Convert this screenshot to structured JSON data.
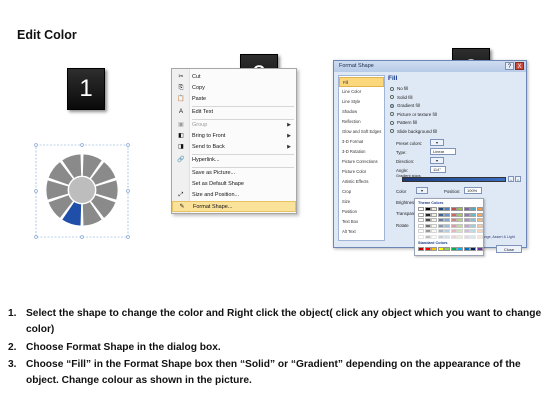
{
  "page": {
    "title": "Edit Color"
  },
  "steps": [
    "1",
    "2",
    "3"
  ],
  "context_menu": {
    "items": [
      {
        "label": "Cut",
        "icon": "scissors-icon",
        "glyph": "✂",
        "disabled": false,
        "submenu": false,
        "highlight": false
      },
      {
        "label": "Copy",
        "icon": "copy-icon",
        "glyph": "⎘",
        "disabled": false,
        "submenu": false,
        "highlight": false
      },
      {
        "label": "Paste",
        "icon": "paste-icon",
        "glyph": "📋",
        "disabled": false,
        "submenu": false,
        "highlight": false
      },
      {
        "sep": true
      },
      {
        "label": "Edit Text",
        "icon": "edit-text-icon",
        "glyph": "A",
        "disabled": false,
        "submenu": false,
        "highlight": false
      },
      {
        "sep": true
      },
      {
        "label": "Group",
        "icon": "group-icon",
        "glyph": "▣",
        "disabled": true,
        "submenu": true,
        "highlight": false
      },
      {
        "label": "Bring to Front",
        "icon": "bring-to-front-icon",
        "glyph": "◧",
        "disabled": false,
        "submenu": true,
        "highlight": false
      },
      {
        "label": "Send to Back",
        "icon": "send-to-back-icon",
        "glyph": "◨",
        "disabled": false,
        "submenu": true,
        "highlight": false
      },
      {
        "sep": true
      },
      {
        "label": "Hyperlink...",
        "icon": "hyperlink-icon",
        "glyph": "🔗",
        "disabled": false,
        "submenu": false,
        "highlight": false
      },
      {
        "sep": true
      },
      {
        "label": "Save as Picture...",
        "icon": "",
        "glyph": "",
        "disabled": false,
        "submenu": false,
        "highlight": false
      },
      {
        "label": "Set as Default Shape",
        "icon": "",
        "glyph": "",
        "disabled": false,
        "submenu": false,
        "highlight": false
      },
      {
        "label": "Size and Position...",
        "icon": "size-position-icon",
        "glyph": "⤢",
        "disabled": false,
        "submenu": false,
        "highlight": false
      },
      {
        "label": "Format Shape...",
        "icon": "format-shape-icon",
        "glyph": "✎",
        "disabled": false,
        "submenu": false,
        "highlight": true
      }
    ]
  },
  "dialog": {
    "title": "Format Shape",
    "help": "?",
    "close": "X",
    "nav": [
      "Fill",
      "Line Color",
      "Line Style",
      "Shadow",
      "Reflection",
      "Glow and Soft Edges",
      "3-D Format",
      "3-D Rotation",
      "Picture Corrections",
      "Picture Color",
      "Artistic Effects",
      "Crop",
      "Size",
      "Position",
      "Text Box",
      "Alt Text"
    ],
    "nav_selected": 0,
    "fill_heading": "Fill",
    "fill_options": [
      "No fill",
      "Solid fill",
      "Gradient fill",
      "Picture or texture fill",
      "Pattern fill",
      "Slide background fill"
    ],
    "fill_selected": 2,
    "preset_label": "Preset colors:",
    "type_label": "Type:",
    "type_value": "Linear",
    "direction_label": "Direction:",
    "angle_label": "Angle:",
    "angle_value": "114°",
    "stops_label": "Gradient stops",
    "color_label": "Color",
    "position_label": "Position:",
    "position_value": "100%",
    "brightness_label": "Brightness",
    "transparency_label": "Transparenc",
    "rotate_label": "Rotate",
    "reset_label": "Change, Assert & Light",
    "close_button": "Close"
  },
  "picker": {
    "theme_heading": "Theme Colors",
    "standard_heading": "Standard Colors",
    "theme_colors": [
      "#ffffff",
      "#000000",
      "#eeece1",
      "#1f497d",
      "#4f81bd",
      "#c0504d",
      "#9bbb59",
      "#8064a2",
      "#4bacc6",
      "#f79646"
    ],
    "standard_colors": [
      "#c00000",
      "#ff0000",
      "#ffc000",
      "#ffff00",
      "#92d050",
      "#00b050",
      "#00b0f0",
      "#0070c0",
      "#002060",
      "#7030a0"
    ]
  },
  "wheel": {
    "segment_color": "#8a8a8a",
    "hub_color": "#bdbdbd",
    "selected_color": "#1f4fa8",
    "selected_index": 5
  },
  "instructions": [
    {
      "num": "1.",
      "text": "Select the shape to change the color and Right click the object( click any object which you want to change color)"
    },
    {
      "num": "2.",
      "text": "Choose Format Shape in the dialog box."
    },
    {
      "num": "3.",
      "text": "Choose “Fill” in the Format Shape box then “Solid” or “Gradient” depending on the appearance of the object. Change colour as shown in the picture."
    }
  ]
}
